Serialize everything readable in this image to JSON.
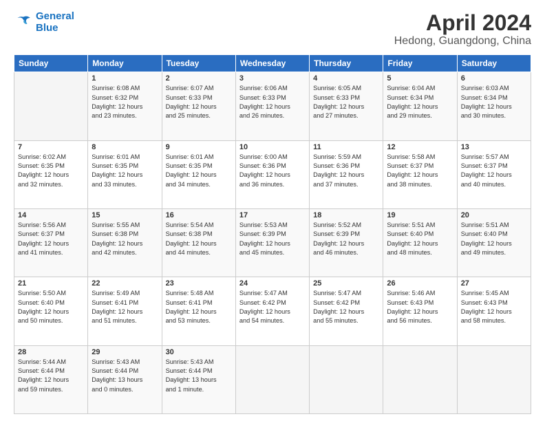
{
  "header": {
    "logo_line1": "General",
    "logo_line2": "Blue",
    "month": "April 2024",
    "location": "Hedong, Guangdong, China"
  },
  "weekdays": [
    "Sunday",
    "Monday",
    "Tuesday",
    "Wednesday",
    "Thursday",
    "Friday",
    "Saturday"
  ],
  "weeks": [
    [
      {
        "day": "",
        "info": ""
      },
      {
        "day": "1",
        "info": "Sunrise: 6:08 AM\nSunset: 6:32 PM\nDaylight: 12 hours\nand 23 minutes."
      },
      {
        "day": "2",
        "info": "Sunrise: 6:07 AM\nSunset: 6:33 PM\nDaylight: 12 hours\nand 25 minutes."
      },
      {
        "day": "3",
        "info": "Sunrise: 6:06 AM\nSunset: 6:33 PM\nDaylight: 12 hours\nand 26 minutes."
      },
      {
        "day": "4",
        "info": "Sunrise: 6:05 AM\nSunset: 6:33 PM\nDaylight: 12 hours\nand 27 minutes."
      },
      {
        "day": "5",
        "info": "Sunrise: 6:04 AM\nSunset: 6:34 PM\nDaylight: 12 hours\nand 29 minutes."
      },
      {
        "day": "6",
        "info": "Sunrise: 6:03 AM\nSunset: 6:34 PM\nDaylight: 12 hours\nand 30 minutes."
      }
    ],
    [
      {
        "day": "7",
        "info": "Sunrise: 6:02 AM\nSunset: 6:35 PM\nDaylight: 12 hours\nand 32 minutes."
      },
      {
        "day": "8",
        "info": "Sunrise: 6:01 AM\nSunset: 6:35 PM\nDaylight: 12 hours\nand 33 minutes."
      },
      {
        "day": "9",
        "info": "Sunrise: 6:01 AM\nSunset: 6:35 PM\nDaylight: 12 hours\nand 34 minutes."
      },
      {
        "day": "10",
        "info": "Sunrise: 6:00 AM\nSunset: 6:36 PM\nDaylight: 12 hours\nand 36 minutes."
      },
      {
        "day": "11",
        "info": "Sunrise: 5:59 AM\nSunset: 6:36 PM\nDaylight: 12 hours\nand 37 minutes."
      },
      {
        "day": "12",
        "info": "Sunrise: 5:58 AM\nSunset: 6:37 PM\nDaylight: 12 hours\nand 38 minutes."
      },
      {
        "day": "13",
        "info": "Sunrise: 5:57 AM\nSunset: 6:37 PM\nDaylight: 12 hours\nand 40 minutes."
      }
    ],
    [
      {
        "day": "14",
        "info": "Sunrise: 5:56 AM\nSunset: 6:37 PM\nDaylight: 12 hours\nand 41 minutes."
      },
      {
        "day": "15",
        "info": "Sunrise: 5:55 AM\nSunset: 6:38 PM\nDaylight: 12 hours\nand 42 minutes."
      },
      {
        "day": "16",
        "info": "Sunrise: 5:54 AM\nSunset: 6:38 PM\nDaylight: 12 hours\nand 44 minutes."
      },
      {
        "day": "17",
        "info": "Sunrise: 5:53 AM\nSunset: 6:39 PM\nDaylight: 12 hours\nand 45 minutes."
      },
      {
        "day": "18",
        "info": "Sunrise: 5:52 AM\nSunset: 6:39 PM\nDaylight: 12 hours\nand 46 minutes."
      },
      {
        "day": "19",
        "info": "Sunrise: 5:51 AM\nSunset: 6:40 PM\nDaylight: 12 hours\nand 48 minutes."
      },
      {
        "day": "20",
        "info": "Sunrise: 5:51 AM\nSunset: 6:40 PM\nDaylight: 12 hours\nand 49 minutes."
      }
    ],
    [
      {
        "day": "21",
        "info": "Sunrise: 5:50 AM\nSunset: 6:40 PM\nDaylight: 12 hours\nand 50 minutes."
      },
      {
        "day": "22",
        "info": "Sunrise: 5:49 AM\nSunset: 6:41 PM\nDaylight: 12 hours\nand 51 minutes."
      },
      {
        "day": "23",
        "info": "Sunrise: 5:48 AM\nSunset: 6:41 PM\nDaylight: 12 hours\nand 53 minutes."
      },
      {
        "day": "24",
        "info": "Sunrise: 5:47 AM\nSunset: 6:42 PM\nDaylight: 12 hours\nand 54 minutes."
      },
      {
        "day": "25",
        "info": "Sunrise: 5:47 AM\nSunset: 6:42 PM\nDaylight: 12 hours\nand 55 minutes."
      },
      {
        "day": "26",
        "info": "Sunrise: 5:46 AM\nSunset: 6:43 PM\nDaylight: 12 hours\nand 56 minutes."
      },
      {
        "day": "27",
        "info": "Sunrise: 5:45 AM\nSunset: 6:43 PM\nDaylight: 12 hours\nand 58 minutes."
      }
    ],
    [
      {
        "day": "28",
        "info": "Sunrise: 5:44 AM\nSunset: 6:44 PM\nDaylight: 12 hours\nand 59 minutes."
      },
      {
        "day": "29",
        "info": "Sunrise: 5:43 AM\nSunset: 6:44 PM\nDaylight: 13 hours\nand 0 minutes."
      },
      {
        "day": "30",
        "info": "Sunrise: 5:43 AM\nSunset: 6:44 PM\nDaylight: 13 hours\nand 1 minute."
      },
      {
        "day": "",
        "info": ""
      },
      {
        "day": "",
        "info": ""
      },
      {
        "day": "",
        "info": ""
      },
      {
        "day": "",
        "info": ""
      }
    ]
  ]
}
